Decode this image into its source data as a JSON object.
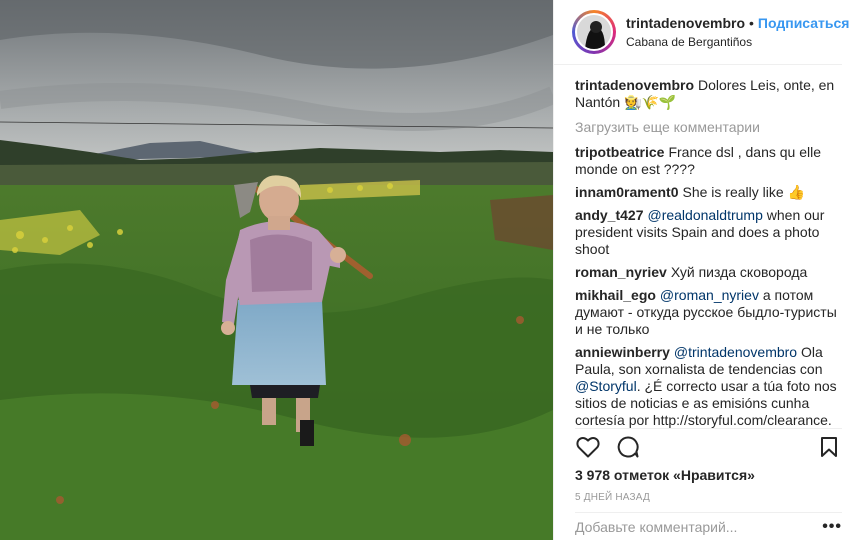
{
  "post": {
    "username": "trintadenovembro",
    "separator": "•",
    "follow_label": "Подписаться",
    "location": "Cabana de Bergantiños",
    "caption_user": "trintadenovembro",
    "caption_text": "Dolores Leis, onte, en Nantón 🧑‍🌾🌾🌱",
    "load_more": "Загрузить еще комментарии",
    "likes": "3 978 отметок «Нравится»",
    "date": "5 ДНЕЙ НАЗАД",
    "comment_placeholder": "Добавьте комментарий...",
    "more_options": "•••"
  },
  "comments": [
    {
      "user": "tripotbeatrice",
      "text": "France dsl , dans qu elle monde on est ????"
    },
    {
      "user": "innam0rament0",
      "text": "She is really like 👍"
    },
    {
      "user": "andy_t427",
      "mention": "@realdonaldtrump",
      "text": " when our president visits Spain and does a photo shoot"
    },
    {
      "user": "roman_nyriev",
      "text": "Хуй пизда сковорода"
    },
    {
      "user": "mikhail_ego",
      "mention": "@roman_nyriev",
      "text": " а потом думают - откуда русское быдло-туристы и не только"
    },
    {
      "user": "anniewinberry",
      "mention": "@trintadenovembro",
      "text": " Ola Paula, son xornalista de tendencias con ",
      "mention2": "@Storyful",
      "text2": ". ¿É correcto usar a túa foto nos sitios de noticias e as emisións cunha cortesía por http://storyful.com/clearance."
    }
  ],
  "icons": {
    "like": "heart-icon",
    "comment": "speech-bubble-icon",
    "save": "bookmark-icon",
    "avatar": "profile-avatar"
  },
  "colors": {
    "accent": "#3897f0",
    "mention": "#003569",
    "muted": "#999999"
  }
}
